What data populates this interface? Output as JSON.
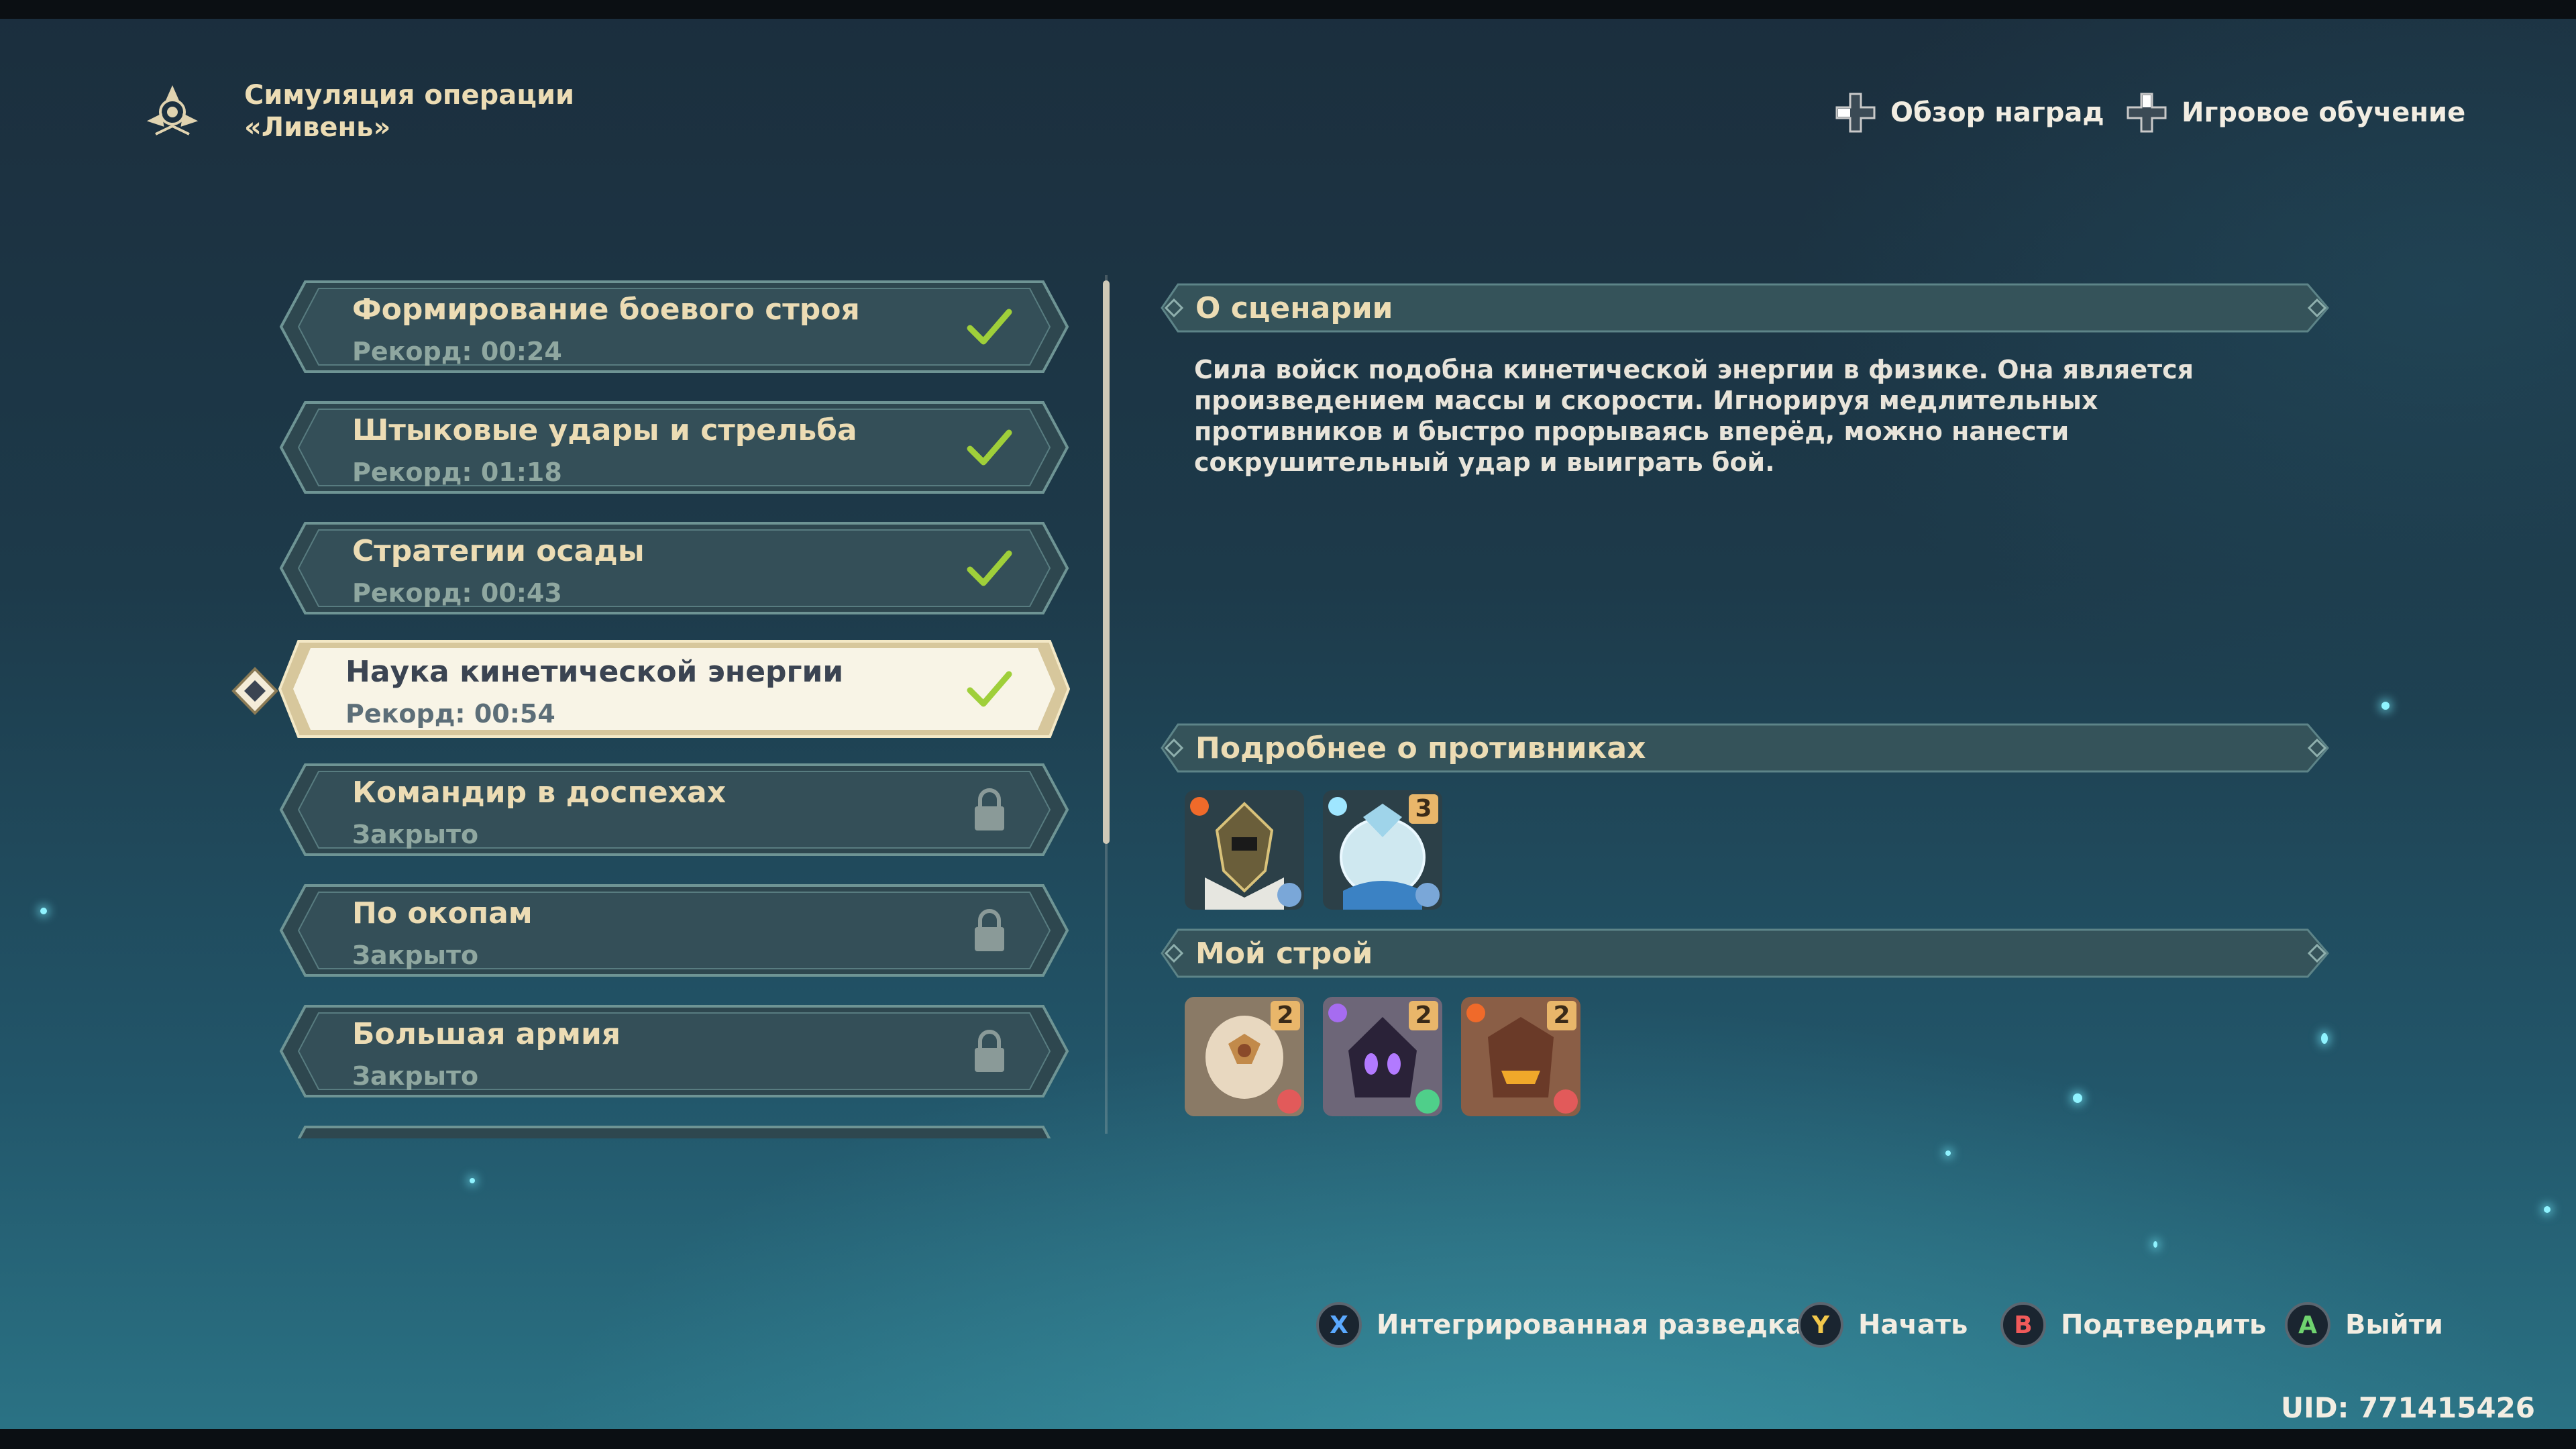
{
  "header": {
    "title_line1": "Симуляция операции",
    "title_line2": "«Ливень»",
    "emblem_icon": "operation-emblem-icon"
  },
  "top_buttons": [
    {
      "label": "Обзор наград",
      "icon": "dpad-left-icon"
    },
    {
      "label": "Игровое обучение",
      "icon": "dpad-up-icon"
    }
  ],
  "stages": [
    {
      "name": "Формирование боевого строя",
      "sub": "Рекорд: 00:24",
      "status": "completed"
    },
    {
      "name": "Штыковые удары и стрельба",
      "sub": "Рекорд: 01:18",
      "status": "completed"
    },
    {
      "name": "Стратегии осады",
      "sub": "Рекорд: 00:43",
      "status": "completed"
    },
    {
      "name": "Наука кинетической энергии",
      "sub": "Рекорд: 00:54",
      "status": "completed",
      "selected": true
    },
    {
      "name": "Командир в доспехах",
      "sub": "Закрыто",
      "status": "locked"
    },
    {
      "name": "По окопам",
      "sub": "Закрыто",
      "status": "locked"
    },
    {
      "name": "Большая армия",
      "sub": "Закрыто",
      "status": "locked"
    }
  ],
  "scenario": {
    "title": "О сценарии",
    "text": "Сила войск подобна кинетической энергии в физике. Она является произведением массы и скорости. Игнорируя медлительных противников и быстро прорываясь вперёд, можно нанести сокрушительный удар и выиграть бой."
  },
  "enemies": {
    "title": "Подробнее о противниках",
    "cards": [
      {
        "name": "pyro-armored-enemy",
        "element": "pyro",
        "count": ""
      },
      {
        "name": "cryo-slime-enemy",
        "element": "cryo",
        "count": "3"
      }
    ]
  },
  "formation": {
    "title": "Мой строй",
    "cards": [
      {
        "name": "hilichurl-mask-unit",
        "element": "none",
        "count": "2"
      },
      {
        "name": "shadow-unit",
        "element": "electro",
        "count": "2"
      },
      {
        "name": "lava-unit",
        "element": "pyro",
        "count": "2"
      }
    ]
  },
  "bottom_buttons": [
    {
      "key": "X",
      "label": "Интегрированная разведка",
      "color": "#5aa9ff"
    },
    {
      "key": "Y",
      "label": "Начать",
      "color": "#f2c84b"
    },
    {
      "key": "B",
      "label": "Подтвердить",
      "color": "#f05a5a"
    },
    {
      "key": "A",
      "label": "Выйти",
      "color": "#6fd36f"
    }
  ],
  "uid": "UID: 771415426",
  "colors": {
    "accent": "#ecdcb4",
    "check": "#9fcf3a",
    "panel": "#2f4a52"
  }
}
